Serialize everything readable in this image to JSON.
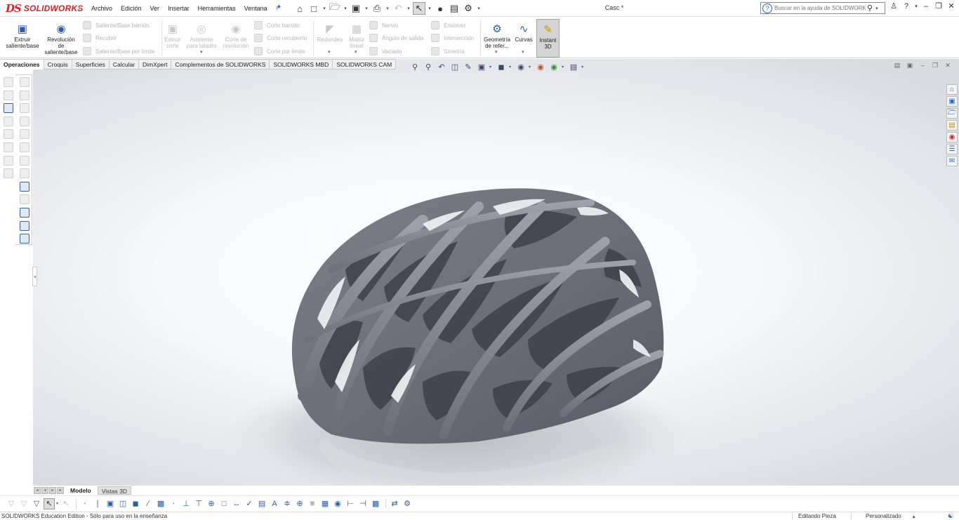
{
  "app": {
    "logo_mark": "DS",
    "logo_text": "SOLIDWORKS",
    "document_title": "Casc *"
  },
  "menu": [
    "Archivo",
    "Edición",
    "Ver",
    "Insertar",
    "Herramientas",
    "Ventana"
  ],
  "help_search": {
    "placeholder": "Buscar en la ayuda de SOLIDWORKS"
  },
  "ribbon": {
    "extrude_boss": "Extruir saliente/base",
    "revolve_boss": "Revolución de saliente/base",
    "swept_boss": "Saliente/Base barrido",
    "loft_boss": "Recubrir",
    "boundary_boss": "Saliente/Base por límite",
    "extruded_cut": "Extruir corte",
    "hole_wizard": "Asistente para taladro",
    "revolved_cut": "Corte de revolución",
    "swept_cut": "Corte barrido",
    "lofted_cut": "Corte recubierto",
    "boundary_cut": "Corte por límite",
    "fillet": "Redondeo",
    "linear_pattern": "Matriz lineal",
    "rib": "Nervio",
    "draft": "Ángulo de salida",
    "shell": "Vaciado",
    "wrap": "Envolver",
    "intersect": "Intersección",
    "mirror": "Simetría",
    "ref_geometry": "Geometría de refer...",
    "curves": "Curvas",
    "instant3d": "Instant 3D"
  },
  "command_tabs": [
    "Operaciones",
    "Croquis",
    "Superficies",
    "Calcular",
    "DimXpert",
    "Complementos de SOLIDWORKS",
    "SOLIDWORKS MBD",
    "SOLIDWORKS CAM"
  ],
  "model_tabs": [
    "Modelo",
    "Vistas 3D"
  ],
  "status": {
    "edition": "SOLIDWORKS Education Edition - Sólo para uso en la enseñanza",
    "editing": "Editando Pieza",
    "units": "Personalizado"
  },
  "icons": {
    "home": "home-icon",
    "new": "new-document-icon",
    "open": "open-folder-icon",
    "save": "save-icon",
    "print": "print-icon",
    "undo": "undo-icon",
    "select": "select-arrow-icon",
    "rebuild": "rebuild-icon",
    "file_properties": "file-properties-icon",
    "options": "gear-icon"
  }
}
